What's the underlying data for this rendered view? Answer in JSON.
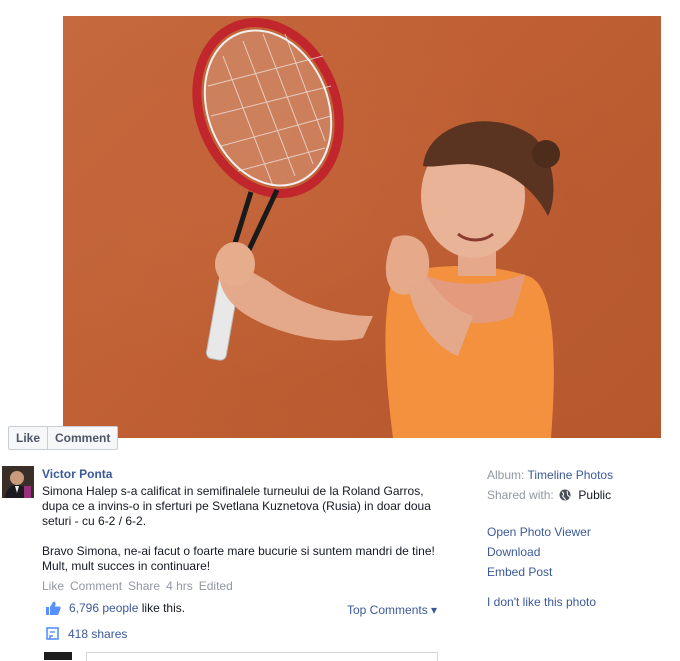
{
  "photo": {
    "alt": ""
  },
  "actions": {
    "like": "Like",
    "comment": "Comment"
  },
  "post": {
    "author": "Victor Ponta",
    "paragraph1": "Simona Halep s-a calificat in semifinalele turneului de la Roland Garros, dupa ce a invins-o in sferturi pe Svetlana Kuznetova (Rusia) in doar doua seturi - cu 6-2 / 6-2.",
    "paragraph2": "Bravo Simona, ne-ai facut o foarte mare bucurie si suntem mandri de tine! Mult, mult succes in continuare!",
    "meta": {
      "like": "Like",
      "comment": "Comment",
      "share": "Share",
      "time": "4 hrs",
      "edited": "Edited"
    },
    "likes": {
      "count": "6,796 people",
      "suffix": "like this."
    },
    "top_comments": "Top Comments ▾",
    "shares": "418 shares"
  },
  "sidebar": {
    "album_label": "Album:",
    "album_value": "Timeline Photos",
    "shared_label": "Shared with:",
    "shared_value": "Public",
    "open_viewer": "Open Photo Viewer",
    "download": "Download",
    "embed": "Embed Post",
    "dislike": "I don't like this photo"
  }
}
